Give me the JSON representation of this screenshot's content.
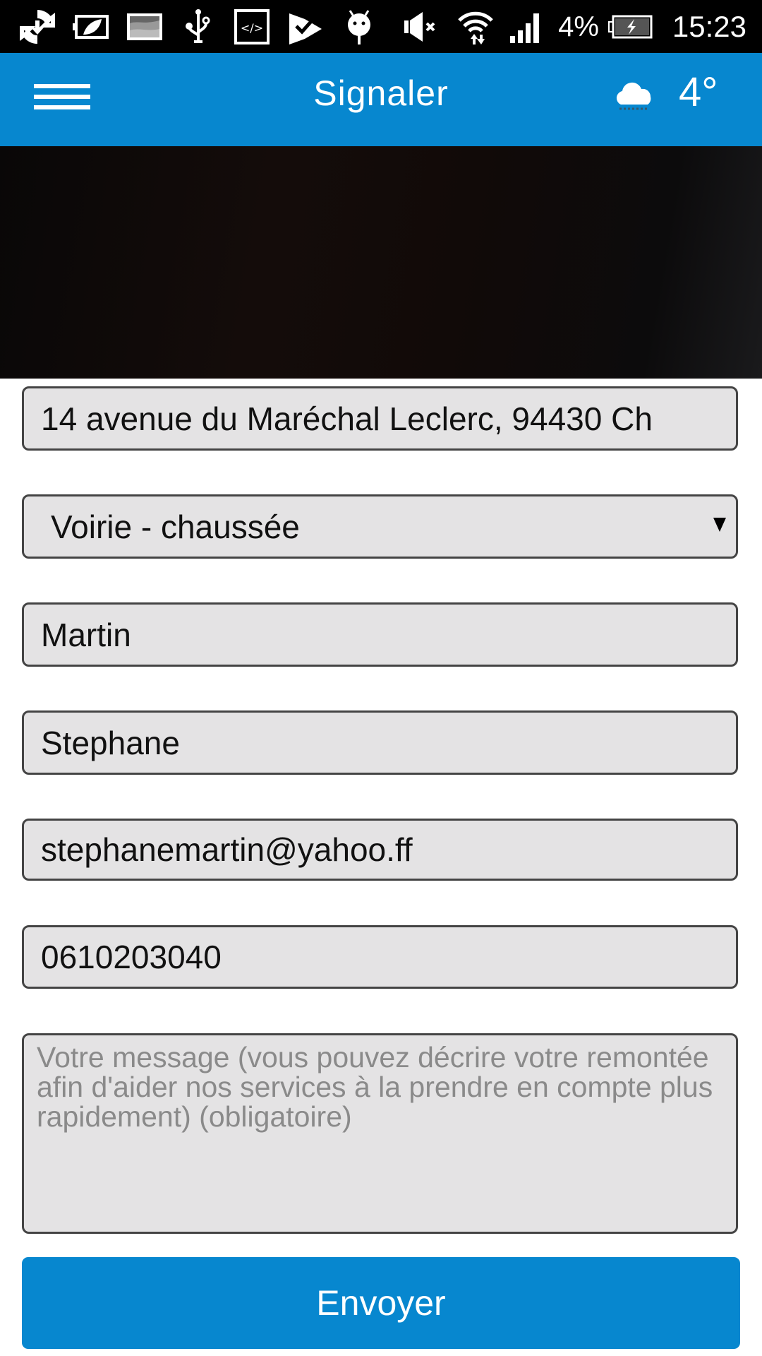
{
  "status_bar": {
    "left_icons": [
      "sync-download-icon",
      "battery-saver-leaf-icon",
      "gallery-image-icon",
      "usb-icon",
      "developer-code-icon",
      "task-check-icon",
      "android-debug-icon"
    ],
    "right_icons": [
      "volume-muted-icon",
      "wifi-data-icon",
      "signal-bars-icon"
    ],
    "battery_percent": "4%",
    "battery_charging": true,
    "time": "15:23"
  },
  "app_bar": {
    "title": "Signaler",
    "menu_icon": "hamburger-menu-icon",
    "weather_icon": "cloud-rain-icon",
    "temperature": "4°"
  },
  "photo": {
    "description": "dark camera photo"
  },
  "form": {
    "address": "14 avenue du Maréchal Leclerc, 94430 Ch",
    "category": "Voirie - chaussée",
    "last_name": "Martin",
    "first_name": "Stephane",
    "email": "stephanemartin@yahoo.ff",
    "phone": "0610203040",
    "message_value": "",
    "message_placeholder": "Votre message (vous pouvez décrire votre remontée afin d'aider nos services à la prendre en compte plus rapidement) (obligatoire)",
    "submit_label": "Envoyer"
  },
  "colors": {
    "primary": "#0787cf",
    "field_bg": "#e4e3e4",
    "field_border": "#444444"
  }
}
